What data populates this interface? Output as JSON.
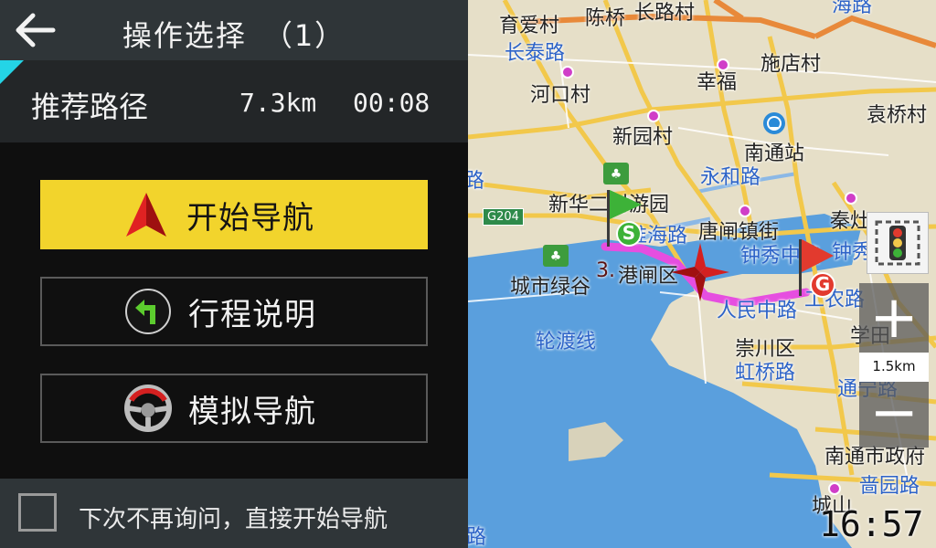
{
  "header": {
    "title": "操作选择　（1）",
    "back_icon": "back-arrow-icon"
  },
  "route": {
    "name": "推荐路径",
    "distance": "7.3km",
    "duration": "00:08"
  },
  "buttons": {
    "start": {
      "label": "开始导航",
      "icon": "navigation-arrow-icon"
    },
    "itinerary": {
      "label": "行程说明",
      "icon": "turn-left-arrow-icon"
    },
    "simulate": {
      "label": "模拟导航",
      "icon": "steering-wheel-icon"
    }
  },
  "footer": {
    "checkbox_label": "下次不再询问，直接开始导航",
    "checked": false
  },
  "map": {
    "labels": {
      "l1": "育爱村",
      "l2": "陈桥",
      "l3": "长路村",
      "l4": "长泰路",
      "l5": "施店村",
      "l6": "幸福",
      "l7": "河口村",
      "l8": "袁桥村",
      "l9": "新园村",
      "l10": "南通站",
      "l11": "永和路",
      "l12": "新华二村游园",
      "l13": "G204",
      "l14": "秦灶",
      "l15": "淮海路",
      "l16": "唐闸镇街",
      "l17": "钟秀中路",
      "l18": "钟秀",
      "l19": "3.",
      "l20": "港闸区",
      "l21": "城市绿谷",
      "l22": "人民中路",
      "l23": "工农路",
      "l24": "学田",
      "l25": "轮渡线",
      "l26": "崇川区",
      "l27": "虹桥路",
      "l28": "通宁路",
      "l29": "南通市政府",
      "l30": "啬园路",
      "l31": "城山",
      "l32": "路",
      "l33": "海路"
    },
    "scale": "1.5km",
    "zoom_in": "+",
    "zoom_out": "−",
    "start_marker": "S",
    "end_marker": "G",
    "clock": "16:57"
  },
  "colors": {
    "accent": "#f2d42c",
    "route": "#e64ee0",
    "water": "#5a9fdd",
    "road": "#f2c84b"
  }
}
